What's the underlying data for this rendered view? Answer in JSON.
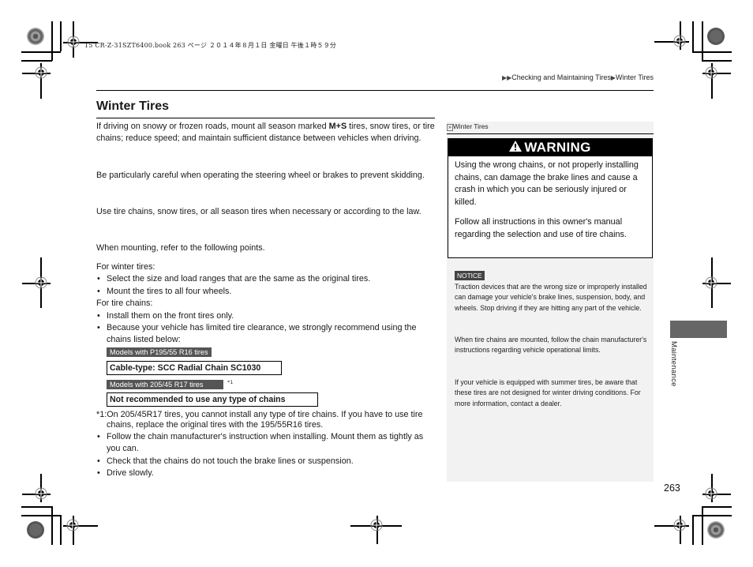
{
  "print_header": {
    "file_info": "15 CR-Z-31SZT6400.book  263 ページ  ２０１４年８月１日  金曜日  午後１時５９分"
  },
  "breadcrumb": {
    "items": [
      "Checking and Maintaining Tires",
      "Winter Tires"
    ],
    "separator_icon": "triangle-right-icon"
  },
  "section": {
    "title": "Winter Tires",
    "intro": {
      "before_bold": "If driving on snowy or frozen roads, mount all season marked ",
      "bold": "M+S",
      "after_bold": " tires, snow tires, or tire chains; reduce speed; and maintain sufficient distance between vehicles when driving."
    },
    "paragraph_2": "Be particularly careful when operating the steering wheel or brakes to prevent skidding.",
    "paragraph_3": "Use tire chains, snow tires, or all season tires when necessary or according to the law.",
    "paragraph_4": "When mounting, refer to the following points.",
    "winter_tires_heading": "For winter tires:",
    "winter_tires_bullets": [
      "Select the size and load ranges that are the same as the original tires.",
      "Mount the tires to all four wheels."
    ],
    "tire_chains_heading": "For tire chains:",
    "tire_chains_bullets": [
      "Install them on the front tires only.",
      "Because your vehicle has limited tire clearance, we strongly recommend using the chains listed below:"
    ],
    "models": [
      {
        "label": "Models with P195/55 R16 tires",
        "chain": "Cable-type: SCC Radial Chain SC1030",
        "footnote_ref": ""
      },
      {
        "label": "Models with 205/45 R17 tires",
        "chain": "Not recommended to use any type of chains",
        "footnote_ref": "*1"
      }
    ],
    "footnote": "*1:On 205/45R17 tires, you cannot install any type of tire chains. If you have to use tire chains, replace the original tires with the 195/55R16 tires.",
    "final_bullets": [
      "Follow the chain manufacturer's instruction when installing. Mount them as tightly as you can.",
      "Check that the chains do not touch the brake lines or suspension.",
      "Drive slowly."
    ]
  },
  "side_panel": {
    "heading": "Winter Tires",
    "warning": {
      "label": "WARNING",
      "paragraphs": [
        "Using the wrong chains, or not properly installing chains, can damage the brake lines and cause a crash in which you can be seriously injured or killed.",
        "Follow all instructions in this owner's manual regarding the selection and use of tire chains."
      ]
    },
    "notice": {
      "label": "NOTICE",
      "text": "Traction devices that are the wrong size or improperly installed can damage your vehicle's brake lines, suspension, body, and wheels. Stop driving if they are hitting any part of the vehicle."
    },
    "note_1": "When tire chains are mounted, follow the chain manufacturer's instructions regarding vehicle operational limits.",
    "note_2": "If your vehicle is equipped with summer tires, be aware that these tires are not designed for winter driving conditions. For more information, contact a dealer."
  },
  "chapter_tab": "Maintenance",
  "page_number": "263",
  "colors": {
    "label_bg": "#555555",
    "side_panel_bg": "#f2f2f2",
    "chapter_tab_bg": "#666666",
    "warning_bar_bg": "#000000"
  }
}
